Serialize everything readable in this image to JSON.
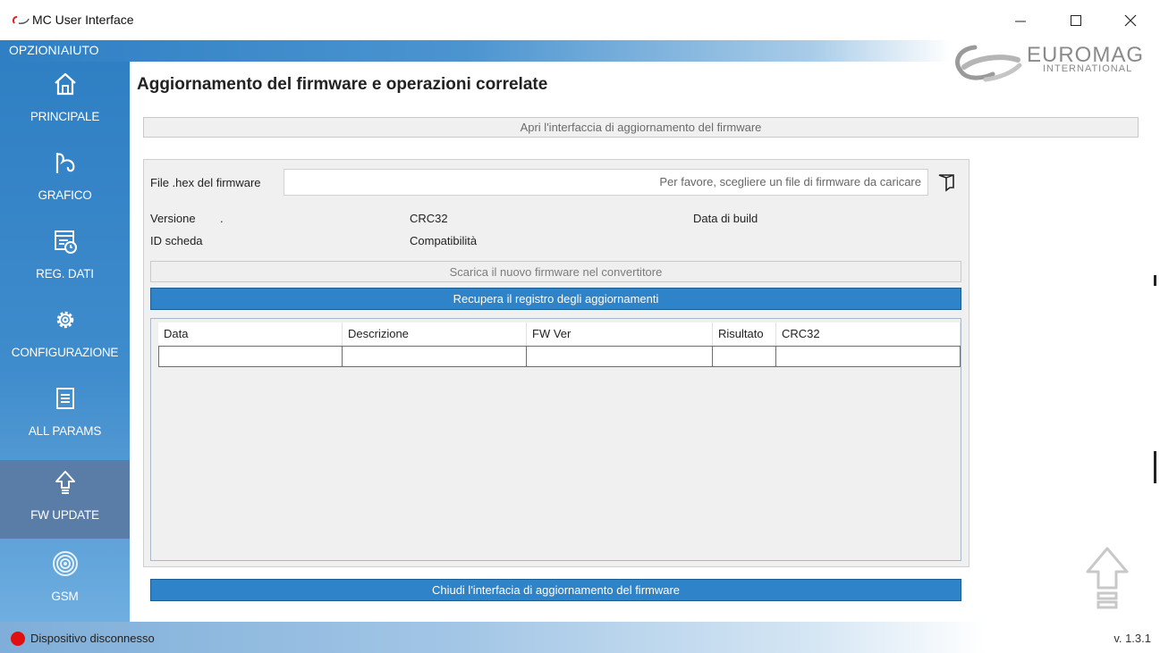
{
  "window": {
    "title": "MC User Interface",
    "minimize": "—",
    "maximize": "☐",
    "close": "✕"
  },
  "menu": {
    "opzioni": "OPZIONI",
    "aiuto": "AIUTO"
  },
  "logo": {
    "brand": "EUROMAG",
    "sub": "INTERNATIONAL"
  },
  "sidebar": {
    "items": [
      {
        "label": "PRINCIPALE",
        "icon": "home-icon",
        "active": false
      },
      {
        "label": "GRAFICO",
        "icon": "chart-icon",
        "active": false
      },
      {
        "label": "REG. DATI",
        "icon": "datalog-icon",
        "active": false
      },
      {
        "label": "CONFIGURAZIONE",
        "icon": "gear-icon",
        "active": false
      },
      {
        "label": "ALL PARAMS",
        "icon": "list-icon",
        "active": false
      },
      {
        "label": "FW UPDATE",
        "icon": "upload-icon",
        "active": true
      },
      {
        "label": "GSM",
        "icon": "antenna-icon",
        "active": false
      }
    ]
  },
  "page": {
    "title": "Aggiornamento del firmware e operazioni correlate",
    "open_button": "Apri l'interfaccia di aggiornamento del firmware",
    "file_label": "File .hex del firmware",
    "file_placeholder": "Per favore, scegliere un file di firmware da caricare",
    "version_label": "Versione",
    "version_value": ".",
    "crc_label": "CRC32",
    "build_date_label": "Data di build",
    "board_id_label": "ID scheda",
    "compat_label": "Compatibilità",
    "flash_button": "Scarica il nuovo firmware nel convertitore",
    "log_button": "Recupera il registro degli aggiornamenti",
    "close_button": "Chiudi l'interfacia di aggiornamento del firmware"
  },
  "table": {
    "columns": [
      "Data",
      "Descrizione",
      "FW Ver",
      "Risultato",
      "CRC32"
    ],
    "rows": [
      [
        "",
        "",
        "",
        "",
        ""
      ]
    ]
  },
  "status": {
    "connection": "Dispositivo disconnesso",
    "connection_color": "#e01010",
    "version": "v. 1.3.1"
  },
  "colors": {
    "accent": "#2f83c8",
    "sidebar": "#2f7fc4",
    "sidebar_active": "#5a7da8"
  }
}
